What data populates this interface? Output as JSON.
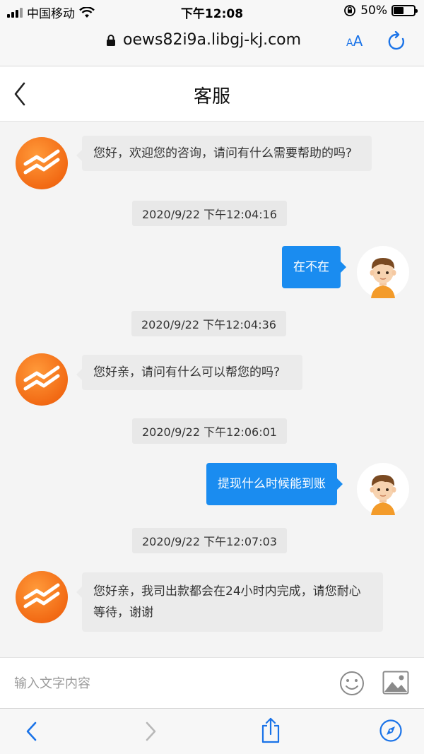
{
  "status_bar": {
    "carrier": "中国移动",
    "time": "下午12:08",
    "battery": "50%",
    "battery_level": 0.5
  },
  "browser": {
    "url": "oews82i9a.libgj-kj.com",
    "text_size_label_small": "A",
    "text_size_label_large": "A"
  },
  "header": {
    "title": "客服"
  },
  "messages": [
    {
      "from": "agent",
      "text": "您好，欢迎您的咨询，请问有什么需要帮助的吗?"
    },
    {
      "from": "timestamp",
      "text": "2020/9/22 下午12:04:16"
    },
    {
      "from": "user",
      "text": "在不在"
    },
    {
      "from": "timestamp",
      "text": "2020/9/22 下午12:04:36"
    },
    {
      "from": "agent",
      "text": "您好亲，请问有什么可以帮您的吗?"
    },
    {
      "from": "timestamp",
      "text": "2020/9/22 下午12:06:01"
    },
    {
      "from": "user",
      "text": "提现什么时候能到账"
    },
    {
      "from": "timestamp",
      "text": "2020/9/22 下午12:07:03"
    },
    {
      "from": "agent",
      "text_line1": "您好亲，我司出款都会在24小时内完成，请您耐心",
      "text_line2": "等待，谢谢"
    }
  ],
  "input": {
    "placeholder": "输入文字内容",
    "value": ""
  },
  "colors": {
    "brand_orange": "#f26a14",
    "user_bubble": "#1a8cf0",
    "ios_blue": "#1a73e8"
  }
}
